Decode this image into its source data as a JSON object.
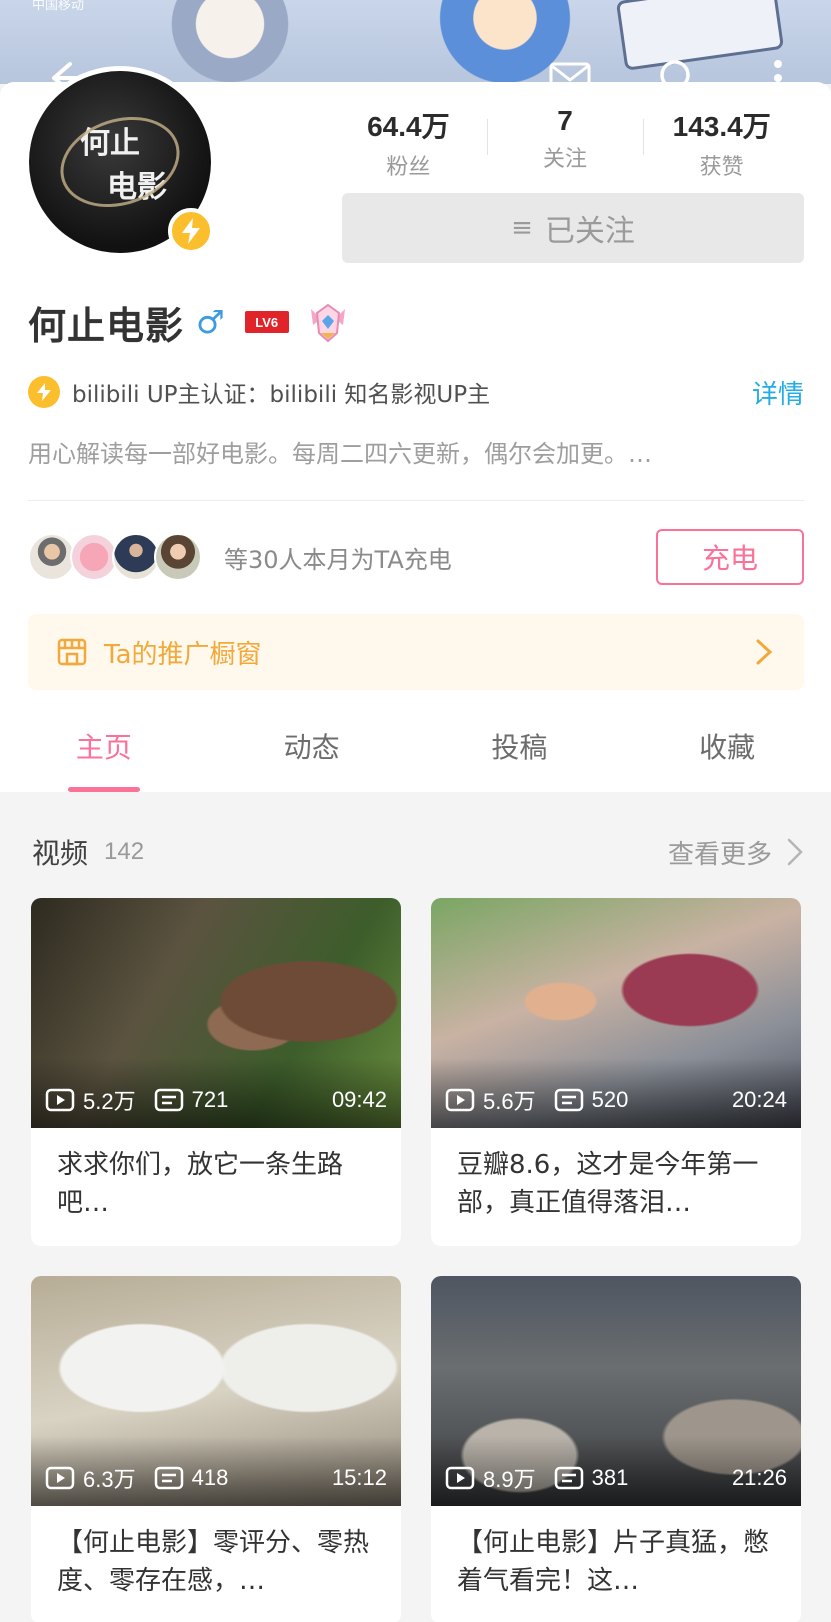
{
  "status_bar": {
    "carrier": "中国移动"
  },
  "profile": {
    "avatar_text_line1": "何止",
    "avatar_text_line2": "电影",
    "name": "何止电影",
    "gender_symbol": "♂",
    "level": "LV6",
    "stats": [
      {
        "value": "64.4万",
        "label": "粉丝"
      },
      {
        "value": "7",
        "label": "关注"
      },
      {
        "value": "143.4万",
        "label": "获赞"
      }
    ],
    "follow_button_label": "已关注",
    "certification": "bilibili UP主认证：bilibili 知名影视UP主",
    "detail_link": "详情",
    "signature": "用心解读每一部好电影。每周二四六更新，偶尔会加更。…"
  },
  "charge": {
    "text": "等30人本月为TA充电",
    "button_label": "充电"
  },
  "shop_window": {
    "label": "Ta的推广橱窗"
  },
  "tabs": [
    {
      "label": "主页",
      "active": true
    },
    {
      "label": "动态",
      "active": false
    },
    {
      "label": "投稿",
      "active": false
    },
    {
      "label": "收藏",
      "active": false
    }
  ],
  "videos_section": {
    "title": "视频",
    "count": "142",
    "more_label": "查看更多",
    "items": [
      {
        "views": "5.2万",
        "danmaku": "721",
        "duration": "09:42",
        "title": "求求你们，放它一条生路吧…"
      },
      {
        "views": "5.6万",
        "danmaku": "520",
        "duration": "20:24",
        "title": "豆瓣8.6，这才是今年第一部，真正值得落泪…"
      },
      {
        "views": "6.3万",
        "danmaku": "418",
        "duration": "15:12",
        "title": "【何止电影】零评分、零热度、零存在感，…"
      },
      {
        "views": "8.9万",
        "danmaku": "381",
        "duration": "21:26",
        "title": "【何止电影】片子真猛，憋着气看完！这…"
      }
    ]
  },
  "colors": {
    "accent_pink": "#fb7299",
    "link_blue": "#23ade5",
    "badge_yellow": "#fbbf2d",
    "shop_orange": "#f2a93b"
  },
  "icons": {
    "back": "back-arrow-icon",
    "message": "mail-icon",
    "search": "search-icon",
    "more": "more-vertical-icon"
  }
}
